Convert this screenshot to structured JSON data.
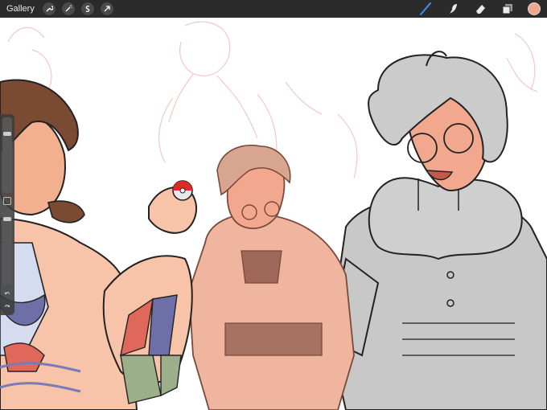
{
  "toolbar": {
    "gallery_label": "Gallery",
    "left_tools": [
      "wrench-icon",
      "magic-wand-icon",
      "selection-icon",
      "transform-arrow-icon"
    ],
    "right_tools": [
      "brush-icon",
      "smudge-icon",
      "eraser-icon",
      "layers-icon"
    ],
    "active_color": "#f0a88a"
  },
  "sidebar": {
    "brush_size": 0.8,
    "brush_opacity": 0.9
  },
  "colors": {
    "skin": "#f2a88e",
    "grey_fill": "#c8c8c8",
    "sketch": "#f2c6c0"
  }
}
